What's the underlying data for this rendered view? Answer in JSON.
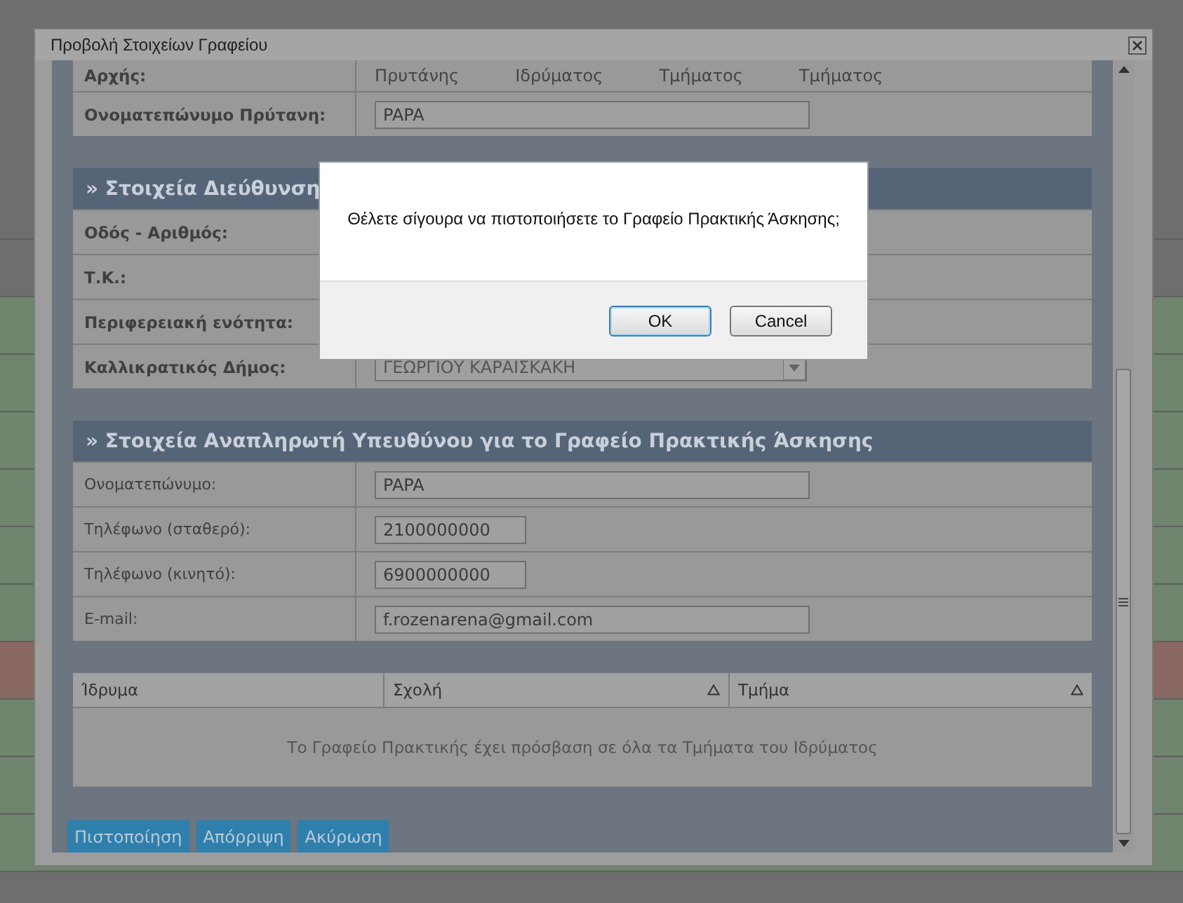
{
  "window": {
    "title": "Προβολή Στοιχείων Γραφείου"
  },
  "background_rows": [
    {
      "color": "#6e6e6e"
    },
    {
      "color": "#6e6e6e"
    },
    {
      "color": "#6f856e"
    },
    {
      "color": "#6f856e"
    },
    {
      "color": "#6f856e"
    },
    {
      "color": "#6f856e"
    },
    {
      "color": "#6f856e"
    },
    {
      "color": "#6f856e"
    },
    {
      "color": "#8a6864"
    },
    {
      "color": "#6f856e"
    },
    {
      "color": "#6f856e"
    },
    {
      "color": "#6f856e"
    }
  ],
  "authority_section": {
    "rows": [
      {
        "label": "Αρχής:",
        "kind": "options",
        "values": [
          "Πρυτάνης",
          "Ιδρύματος",
          "Τμήματος",
          "Τμήματος"
        ]
      },
      {
        "label": "Ονοματεπώνυμο Πρύτανη:",
        "kind": "field",
        "value": "PAPA"
      }
    ]
  },
  "address_section": {
    "title": "» Στοιχεία Διεύθυνση",
    "rows": [
      {
        "label": "Οδός - Αριθμός:",
        "kind": "blank"
      },
      {
        "label": "Τ.Κ.:",
        "kind": "blank"
      },
      {
        "label": "Περιφερειακή ενότητα:",
        "kind": "blank"
      },
      {
        "label": "Καλλικρατικός Δήμος:",
        "kind": "dropdown",
        "value": "ΓΕΩΡΓΙΟΥ ΚΑΡΑΙΣΚΑΚΗ"
      }
    ]
  },
  "deputy_section": {
    "title": "» Στοιχεία Αναπληρωτή Υπευθύνου για το Γραφείο Πρακτικής Άσκησης",
    "rows": [
      {
        "label": "Ονοματεπώνυμο:",
        "kind": "wide",
        "value": "PAPA"
      },
      {
        "label": "Τηλέφωνο (σταθερό):",
        "kind": "short",
        "value": "2100000000"
      },
      {
        "label": "Τηλέφωνο (κινητό):",
        "kind": "short",
        "value": "6900000000"
      },
      {
        "label": "E-mail:",
        "kind": "wide",
        "value": "f.rozenarena@gmail.com"
      }
    ]
  },
  "table": {
    "columns": [
      {
        "label": "Ίδρυμα",
        "sortable": false
      },
      {
        "label": "Σχολή",
        "sortable": true
      },
      {
        "label": "Τμήμα",
        "sortable": true
      }
    ],
    "empty_message": "Το Γραφείο Πρακτικής έχει πρόσβαση σε όλα τα Τμήματα του Ιδρύματος"
  },
  "buttons": [
    "Πιστοποίηση",
    "Απόρριψη",
    "Ακύρωση"
  ],
  "confirm": {
    "message": "Θέλετε σίγουρα να πιστοποιήσετε το Γραφείο Πρακτικής Άσκησης;",
    "buttons": [
      {
        "label": "OK",
        "selected": true
      },
      {
        "label": "Cancel",
        "selected": false
      }
    ]
  }
}
